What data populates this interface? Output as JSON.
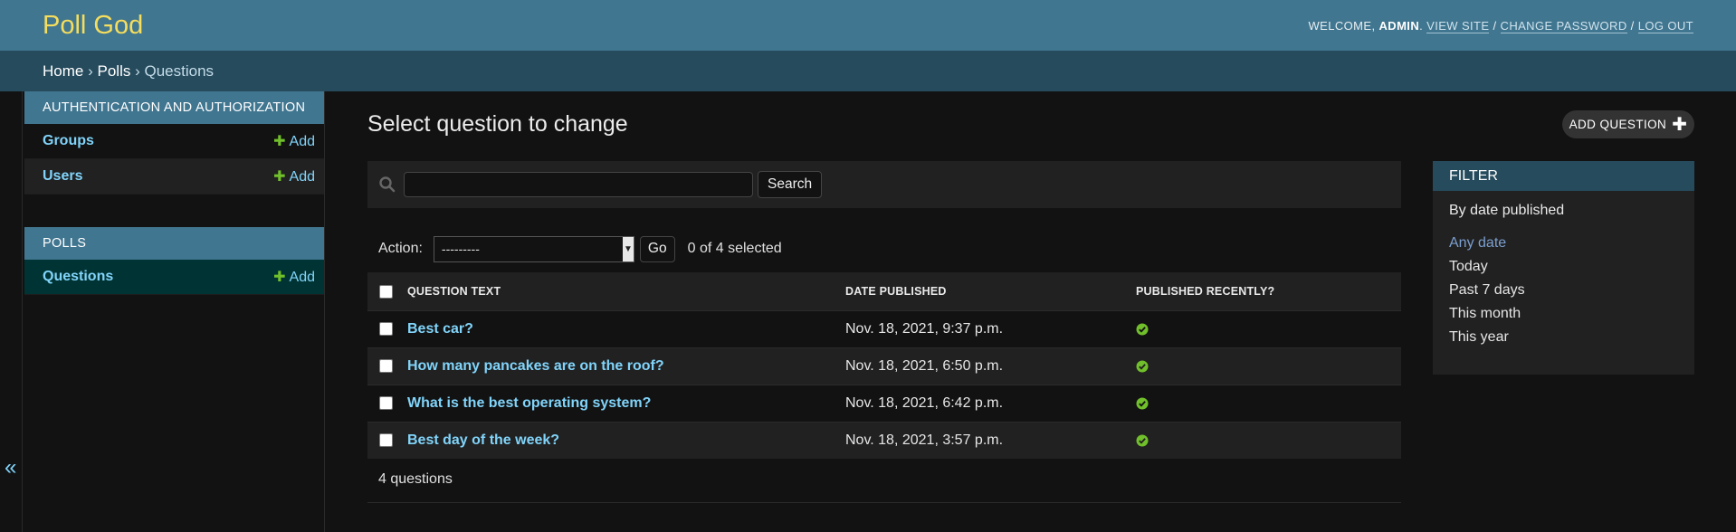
{
  "header": {
    "branding": "Poll God",
    "welcome": "Welcome,",
    "username": "admin",
    "view_site": "View site",
    "change_password": "Change password",
    "log_out": "Log out",
    "sep": "/"
  },
  "breadcrumbs": {
    "home": "Home",
    "app": "Polls",
    "current": "Questions",
    "sep": "›"
  },
  "sidebar": {
    "toggle": "«",
    "modules": [
      {
        "caption": "Authentication and Authorization",
        "models": [
          {
            "name": "Groups",
            "add": "Add"
          },
          {
            "name": "Users",
            "add": "Add"
          }
        ]
      },
      {
        "caption": "Polls",
        "models": [
          {
            "name": "Questions",
            "add": "Add"
          }
        ]
      }
    ]
  },
  "content": {
    "title": "Select question to change",
    "add_button": "Add question",
    "search_button": "Search",
    "search_value": "",
    "action_label": "Action:",
    "action_selected": "---------",
    "go_button": "Go",
    "action_counter": "0 of 4 selected",
    "paginator": "4 questions"
  },
  "table": {
    "columns": [
      "Question text",
      "Date published",
      "Published recently?"
    ],
    "rows": [
      {
        "question": "Best car?",
        "date": "Nov. 18, 2021, 9:37 p.m.",
        "recent": "yes"
      },
      {
        "question": "How many pancakes are on the roof?",
        "date": "Nov. 18, 2021, 6:50 p.m.",
        "recent": "yes"
      },
      {
        "question": "What is the best operating system?",
        "date": "Nov. 18, 2021, 6:42 p.m.",
        "recent": "yes"
      },
      {
        "question": "Best day of the week?",
        "date": "Nov. 18, 2021, 3:57 p.m.",
        "recent": "yes"
      }
    ]
  },
  "filter": {
    "title": "Filter",
    "section": "By date published",
    "choices": [
      "Any date",
      "Today",
      "Past 7 days",
      "This month",
      "This year"
    ],
    "selected": "Any date"
  },
  "icons": {
    "search": "search-icon",
    "add": "plus-icon",
    "published": "check-circle-icon"
  },
  "colors": {
    "header_bg": "#417690",
    "branding": "#f5dd5d",
    "breadcrumbs_bg": "#264b5d",
    "link": "#81d4fa",
    "add_plus": "#70bf2b",
    "yes_icon": "#70bf2b",
    "current_row": "#003333"
  }
}
